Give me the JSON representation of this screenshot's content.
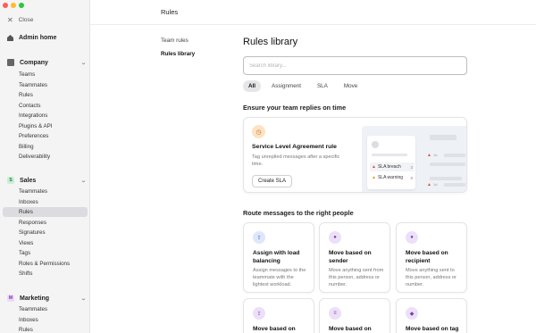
{
  "window": {
    "traffic_colors": [
      "#fe5f57",
      "#febc2e",
      "#28c840"
    ]
  },
  "sidebar": {
    "close_label": "Close",
    "admin_home": "Admin home",
    "company": {
      "label": "Company",
      "items": [
        "Teams",
        "Teammates",
        "Rules",
        "Contacts",
        "Integrations",
        "Plugins & API",
        "Preferences",
        "Billing",
        "Deliverability"
      ]
    },
    "sales": {
      "badge": "S",
      "label": "Sales",
      "items": [
        "Teammates",
        "Inboxes",
        "Rules",
        "Responses",
        "Signatures",
        "Views",
        "Tags",
        "Roles & Permissions",
        "Shifts"
      ],
      "active_item": "Rules"
    },
    "marketing": {
      "badge": "M",
      "label": "Marketing",
      "items": [
        "Teammates",
        "Inboxes",
        "Rules"
      ]
    }
  },
  "header": {
    "title": "Rules"
  },
  "subnav": {
    "items": [
      "Team rules",
      "Rules library"
    ],
    "active": "Rules library"
  },
  "main": {
    "title": "Rules library",
    "search_placeholder": "Search library...",
    "tabs": [
      "All",
      "Assignment",
      "SLA",
      "Move"
    ],
    "active_tab": "All",
    "section1_title": "Ensure your team replies on time",
    "promo": {
      "title": "Service Level Agreement rule",
      "description": "Tag unreplied messages after a specific time.",
      "button": "Create SLA",
      "illustration": {
        "rows": [
          {
            "label": "SLA breach",
            "count": "3"
          },
          {
            "label": "SLA warning",
            "count": "9"
          }
        ],
        "side_tags": [
          "1d",
          "1d"
        ]
      }
    },
    "section2_title": "Route messages to the right people",
    "cards": [
      {
        "title": "Assign with load balancing",
        "description": "Assign messages to the teammate with the lightest workload.",
        "icon": "assign-icon"
      },
      {
        "title": "Move based on sender",
        "description": "Move anything sent from this person, address or number.",
        "icon": "user-icon"
      },
      {
        "title": "Move based on recipient",
        "description": "Move anything sent to this person, address or number.",
        "icon": "user-icon"
      },
      {
        "title": "Move based on",
        "description": "",
        "icon": "assign-icon"
      },
      {
        "title": "Move based on",
        "description": "",
        "icon": "text-icon"
      },
      {
        "title": "Move based on tag",
        "description": "",
        "icon": "tag-icon"
      }
    ]
  }
}
